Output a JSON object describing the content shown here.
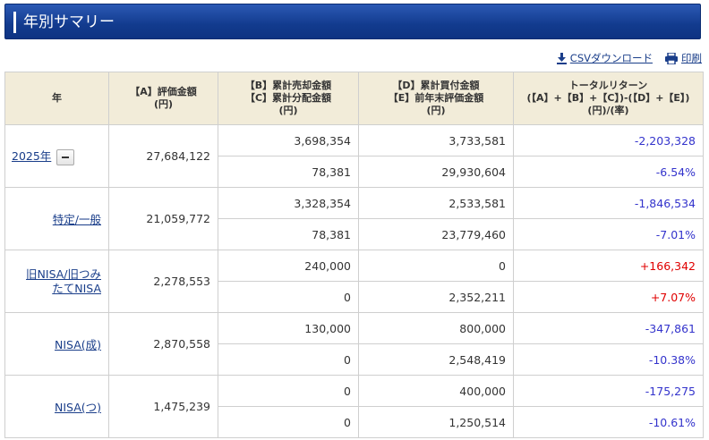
{
  "page": {
    "title": "年別サマリー"
  },
  "tools": {
    "csv_label": "CSVダウンロード",
    "print_label": "印刷"
  },
  "headers": {
    "year": "年",
    "a": [
      "【A】評価金額",
      "(円)"
    ],
    "bc": [
      "【B】累計売却金額",
      "【C】累計分配金額",
      "(円)"
    ],
    "de": [
      "【D】累計買付金額",
      "【E】前年末評価金額",
      "(円)"
    ],
    "tr": [
      "トータルリターン",
      "(【A】+【B】+【C】)-(【D】+【E】)",
      "(円)/(率)"
    ]
  },
  "rows": [
    {
      "name": "2025年",
      "a": "27,684,122",
      "b": "3,698,354",
      "c": "78,381",
      "d": "3,733,581",
      "e": "29,930,604",
      "tr_yen": "-2,203,328",
      "tr_pct": "-6.54%",
      "sign": "neg"
    },
    {
      "name": "特定/一般",
      "a": "21,059,772",
      "b": "3,328,354",
      "c": "78,381",
      "d": "2,533,581",
      "e": "23,779,460",
      "tr_yen": "-1,846,534",
      "tr_pct": "-7.01%",
      "sign": "neg"
    },
    {
      "name_lines": [
        "旧NISA/旧つみ",
        "たてNISA"
      ],
      "a": "2,278,553",
      "b": "240,000",
      "c": "0",
      "d": "0",
      "e": "2,352,211",
      "tr_yen": "+166,342",
      "tr_pct": "+7.07%",
      "sign": "pos"
    },
    {
      "name": "NISA(成)",
      "a": "2,870,558",
      "b": "130,000",
      "c": "0",
      "d": "800,000",
      "e": "2,548,419",
      "tr_yen": "-347,861",
      "tr_pct": "-10.38%",
      "sign": "neg"
    },
    {
      "name": "NISA(つ)",
      "a": "1,475,239",
      "b": "0",
      "c": "0",
      "d": "400,000",
      "e": "1,250,514",
      "tr_yen": "-175,275",
      "tr_pct": "-10.61%",
      "sign": "neg"
    }
  ],
  "colors": {
    "title_bg": "#123b8e",
    "header_bg": "#f2ecd9",
    "negative": "#3333cc",
    "positive": "#e00000",
    "link": "#1a3e8a"
  }
}
